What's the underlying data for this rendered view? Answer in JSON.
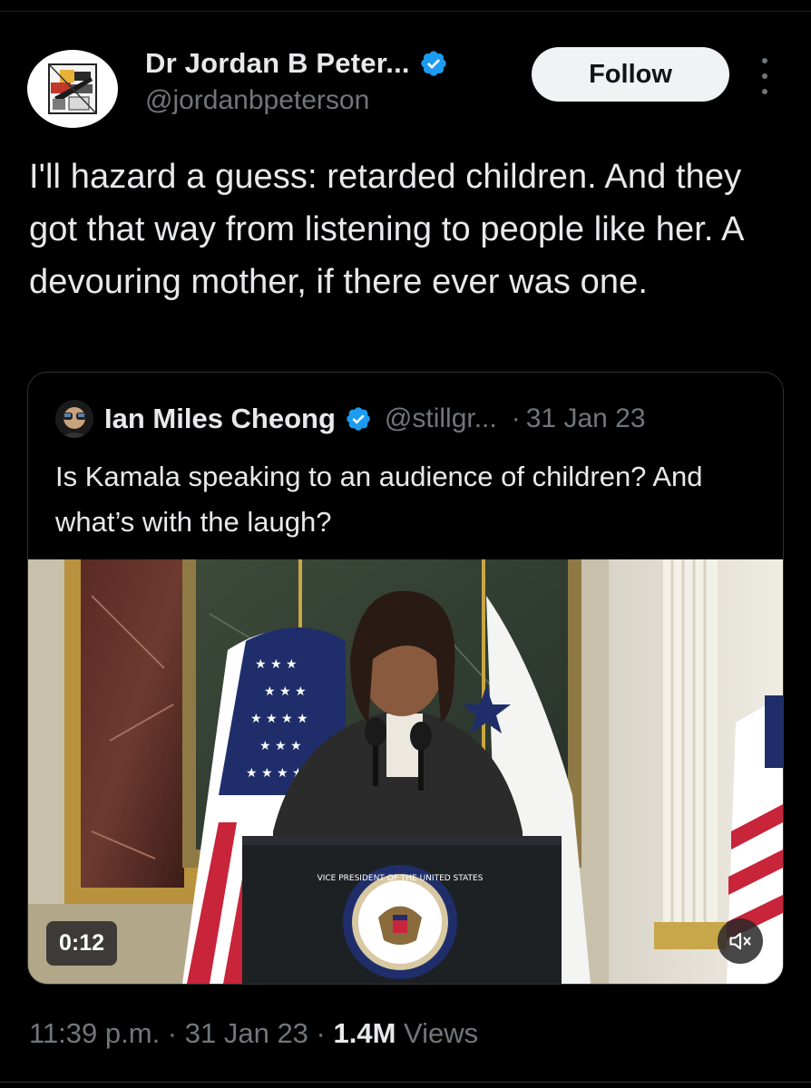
{
  "tweet": {
    "author": {
      "display_name": "Dr Jordan B Peter...",
      "handle": "@jordanbpeterson",
      "verified": true,
      "verified_color": "#1d9bf0",
      "avatar_icon": "abstract-logo-avatar"
    },
    "follow_label": "Follow",
    "more_icon": "more-vertical-icon",
    "text": "I'll hazard a guess:  retarded children. And they got that way from listening to people like her. A devouring mother, if there ever was one.",
    "quoted": {
      "display_name": "Ian Miles Cheong",
      "handle": "@stillgr...",
      "separator": "·",
      "date": "31 Jan 23",
      "verified": true,
      "text": "Is Kamala speaking to an audience of children? And what’s with the laugh?",
      "video": {
        "duration": "0:12",
        "muted": true,
        "mute_icon": "speaker-muted-icon",
        "seal_text": "VICE PRESIDENT OF THE UNITED STATES"
      }
    },
    "meta": {
      "time": "11:39 p.m.",
      "sep1": " · ",
      "date": "31 Jan 23",
      "sep2": " · ",
      "views_count": "1.4M",
      "views_label": " Views"
    }
  },
  "colors": {
    "background": "#000000",
    "text_primary": "#e7e9ea",
    "text_secondary": "#71767b",
    "border": "#2f3336",
    "follow_bg": "#eff3f4",
    "follow_text": "#0f1419",
    "verified": "#1d9bf0"
  }
}
